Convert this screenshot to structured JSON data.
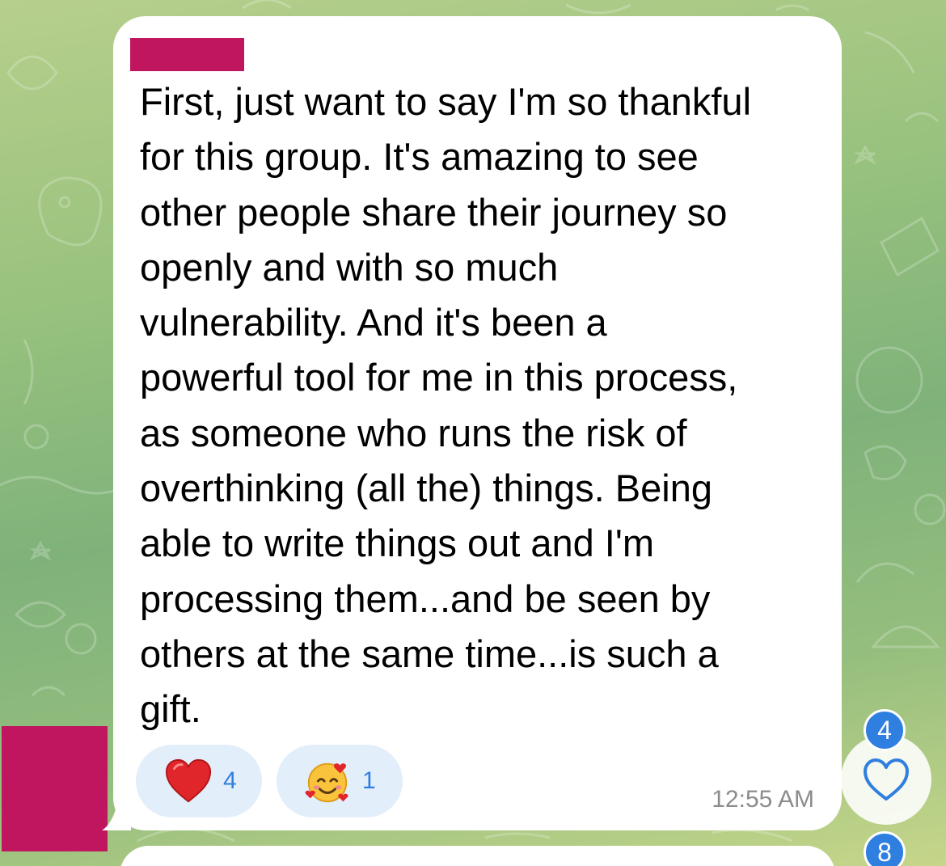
{
  "message": {
    "text": "First, just want to say I'm so thankful\nfor this group. It's amazing to see\nother people share their journey so\nopenly and with so much\nvulnerability. And it's been a\npowerful tool for me in this process,\nas someone who runs the risk of\noverthinking (all the) things. Being\nable to write things out and I'm\nprocessing them...and be seen by\nothers at the same time...is such a\ngift.",
    "time": "12:55 AM",
    "reactions": [
      {
        "icon": "red-heart-icon",
        "count": "4"
      },
      {
        "icon": "smiling-face-with-hearts-icon",
        "count": "1"
      }
    ]
  },
  "side_controls": {
    "reactions_badge": "4",
    "react_button_icon": "heart-outline-icon",
    "mentions_badge": "8"
  },
  "colors": {
    "redaction": "#c0155f",
    "accent": "#2f7fe0",
    "reaction_pill": "#e3eefb",
    "bubble": "#ffffff"
  }
}
